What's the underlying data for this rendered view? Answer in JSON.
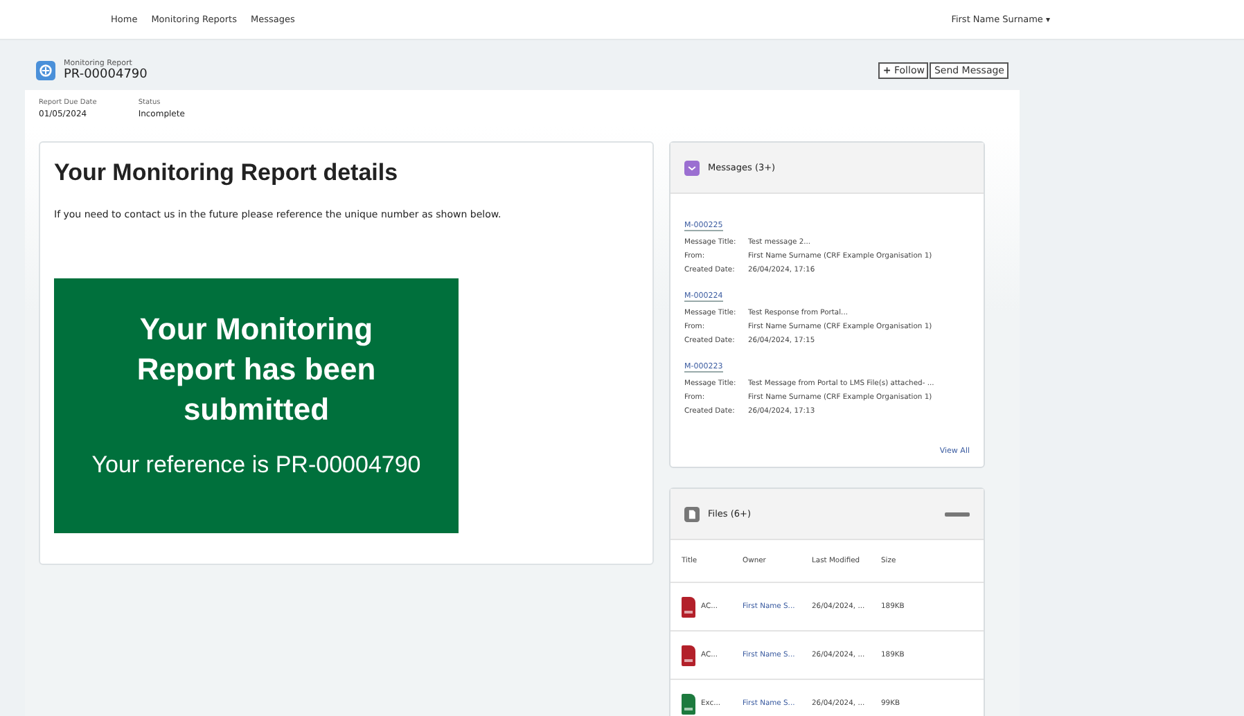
{
  "nav": {
    "links": [
      "Home",
      "Monitoring Reports",
      "Messages"
    ],
    "user": "First Name Surname",
    "user_caret": "▾"
  },
  "header": {
    "object_type": "Monitoring Report",
    "record": "PR-00004790",
    "buttons": [
      {
        "kind": "follow",
        "label": "Follow",
        "icon": "+"
      },
      {
        "kind": "plain",
        "label": "Send Message"
      }
    ]
  },
  "fields": [
    {
      "label": "Report Due Date",
      "value": "01/05/2024"
    },
    {
      "label": "Status",
      "value": "Incomplete"
    }
  ],
  "details": {
    "title": "Your Monitoring Report details",
    "text": "If you need to contact us in the future please reference the unique number as shown below.",
    "banner_title": "Your Monitoring Report has been submitted",
    "banner_reference": "Your reference is PR-00004790"
  },
  "messages": {
    "title": "Messages (3+)",
    "items": [
      {
        "id": "M-000225",
        "rows": [
          {
            "label": "Message Title:",
            "value": "Test message 2..."
          },
          {
            "label": "From:",
            "value": "First Name Surname (CRF Example Organisation 1)"
          },
          {
            "label": "Created Date:",
            "value": "26/04/2024, 17:16"
          }
        ]
      },
      {
        "id": "M-000224",
        "rows": [
          {
            "label": "Message Title:",
            "value": "Test Response from Portal..."
          },
          {
            "label": "From:",
            "value": "First Name Surname (CRF Example Organisation 1)"
          },
          {
            "label": "Created Date:",
            "value": "26/04/2024, 17:15"
          }
        ]
      },
      {
        "id": "M-000223",
        "rows": [
          {
            "label": "Message Title:",
            "value": "Test Message from Portal to LMS File(s) attached- ..."
          },
          {
            "label": "From:",
            "value": "First Name Surname (CRF Example Organisation 1)"
          },
          {
            "label": "Created Date:",
            "value": "26/04/2024, 17:13"
          }
        ]
      }
    ],
    "view_all": "View All"
  },
  "files": {
    "title": "Files (6+)",
    "columns": [
      "Title",
      "Owner",
      "Last Modified",
      "Size"
    ],
    "rows": [
      {
        "kind": "pdf",
        "title": "AC...",
        "owner": "First Name S...",
        "modified": "26/04/2024, ...",
        "size": "189KB"
      },
      {
        "kind": "pdf",
        "title": "AC...",
        "owner": "First Name S...",
        "modified": "26/04/2024, ...",
        "size": "189KB"
      },
      {
        "kind": "xls",
        "title": "Exc...",
        "owner": "First Name S...",
        "modified": "26/04/2024, ...",
        "size": "99KB"
      }
    ]
  }
}
